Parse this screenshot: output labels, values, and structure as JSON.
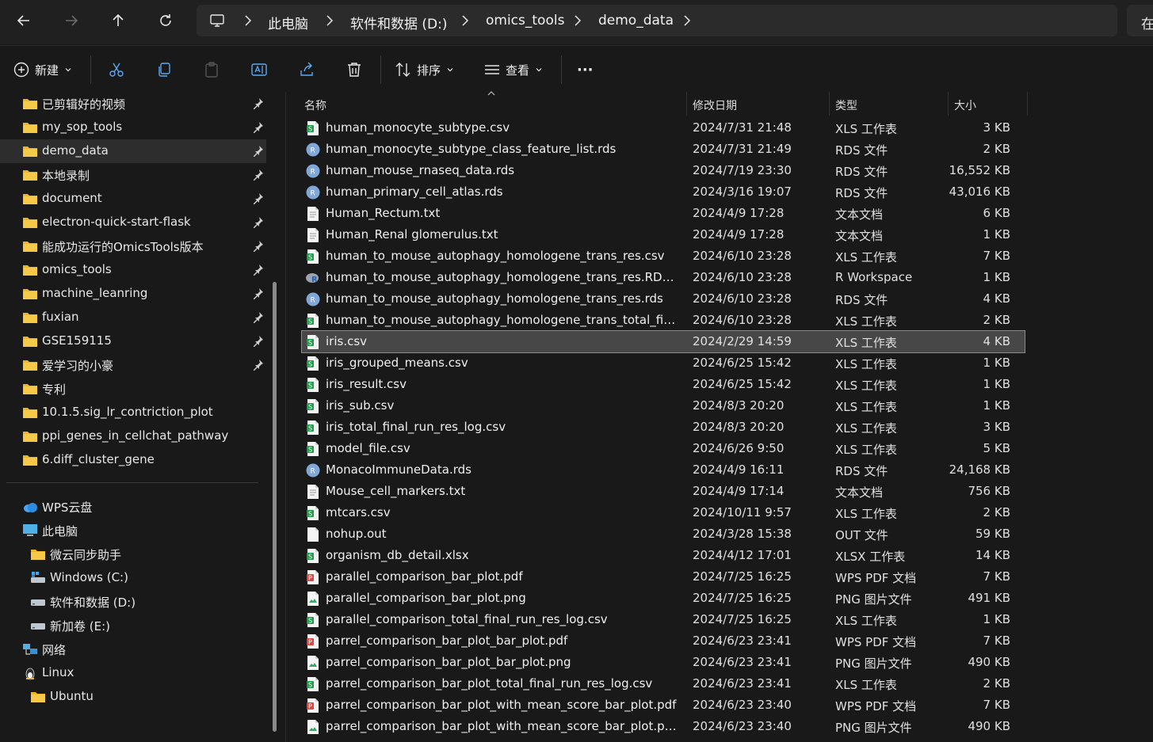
{
  "nav": {
    "back_icon": "arrow-left-icon",
    "forward_icon": "arrow-right-icon",
    "up_icon": "arrow-up-icon",
    "refresh_icon": "refresh-icon"
  },
  "breadcrumb": [
    {
      "label": "此电脑"
    },
    {
      "label": "软件和数据 (D:)"
    },
    {
      "label": "omics_tools"
    },
    {
      "label": "demo_data"
    }
  ],
  "search": {
    "label": "在"
  },
  "toolbar": {
    "new_label": "新建",
    "sort_label": "排序",
    "view_label": "查看",
    "more_label": "···"
  },
  "sidebar": {
    "quick": [
      {
        "label": "已剪辑好的视频",
        "pinned": true
      },
      {
        "label": "my_sop_tools",
        "pinned": true
      },
      {
        "label": "demo_data",
        "pinned": true,
        "selected": true
      },
      {
        "label": "本地录制",
        "pinned": true
      },
      {
        "label": "document",
        "pinned": true
      },
      {
        "label": "electron-quick-start-flask",
        "pinned": true
      },
      {
        "label": "能成功运行的OmicsTools版本",
        "pinned": true
      },
      {
        "label": "omics_tools",
        "pinned": true
      },
      {
        "label": "machine_leanring",
        "pinned": true
      },
      {
        "label": "fuxian",
        "pinned": true
      },
      {
        "label": "GSE159115",
        "pinned": true
      },
      {
        "label": "爱学习的小豪",
        "pinned": true
      },
      {
        "label": "专利",
        "pinned": false
      },
      {
        "label": "10.1.5.sig_lr_contriction_plot",
        "pinned": false
      },
      {
        "label": "ppi_genes_in_cellchat_pathway",
        "pinned": false
      },
      {
        "label": "6.diff_cluster_gene",
        "pinned": false
      }
    ],
    "tree": [
      {
        "label": "WPS云盘",
        "icon": "cloud-icon",
        "indent": 0
      },
      {
        "label": "此电脑",
        "icon": "computer-icon",
        "indent": 0
      },
      {
        "label": "微云同步助手",
        "icon": "folder-icon",
        "indent": 1
      },
      {
        "label": "Windows  (C:)",
        "icon": "windows-drive-icon",
        "indent": 1
      },
      {
        "label": "软件和数据 (D:)",
        "icon": "drive-icon",
        "indent": 1
      },
      {
        "label": "新加卷 (E:)",
        "icon": "drive-icon",
        "indent": 1
      },
      {
        "label": "网络",
        "icon": "network-icon",
        "indent": 0
      },
      {
        "label": "Linux",
        "icon": "linux-icon",
        "indent": 0
      },
      {
        "label": "Ubuntu",
        "icon": "folder-icon",
        "indent": 1
      }
    ]
  },
  "columns": {
    "name": "名称",
    "date": "修改日期",
    "type": "类型",
    "size": "大小"
  },
  "files": [
    {
      "name": "human_monocyte_subtype.csv",
      "date": "2024/7/31 21:48",
      "type": "XLS 工作表",
      "size": "3 KB",
      "icon": "csv"
    },
    {
      "name": "human_monocyte_subtype_class_feature_list.rds",
      "date": "2024/7/31 21:49",
      "type": "RDS 文件",
      "size": "2 KB",
      "icon": "rds"
    },
    {
      "name": "human_mouse_rnaseq_data.rds",
      "date": "2024/7/19 23:30",
      "type": "RDS 文件",
      "size": "16,552 KB",
      "icon": "rds"
    },
    {
      "name": "human_primary_cell_atlas.rds",
      "date": "2024/3/16 19:07",
      "type": "RDS 文件",
      "size": "43,016 KB",
      "icon": "rds"
    },
    {
      "name": "Human_Rectum.txt",
      "date": "2024/4/9 17:28",
      "type": "文本文档",
      "size": "6 KB",
      "icon": "txt"
    },
    {
      "name": "Human_Renal glomerulus.txt",
      "date": "2024/4/9 17:28",
      "type": "文本文档",
      "size": "1 KB",
      "icon": "txt"
    },
    {
      "name": "human_to_mouse_autophagy_homologene_trans_res.csv",
      "date": "2024/6/10 23:28",
      "type": "XLS 工作表",
      "size": "7 KB",
      "icon": "csv"
    },
    {
      "name": "human_to_mouse_autophagy_homologene_trans_res.RData",
      "date": "2024/6/10 23:28",
      "type": "R Workspace",
      "size": "1 KB",
      "icon": "rdata"
    },
    {
      "name": "human_to_mouse_autophagy_homologene_trans_res.rds",
      "date": "2024/6/10 23:28",
      "type": "RDS 文件",
      "size": "4 KB",
      "icon": "rds"
    },
    {
      "name": "human_to_mouse_autophagy_homologene_trans_total_fina...",
      "date": "2024/6/10 23:28",
      "type": "XLS 工作表",
      "size": "2 KB",
      "icon": "csv"
    },
    {
      "name": "iris.csv",
      "date": "2024/2/29 14:59",
      "type": "XLS 工作表",
      "size": "4 KB",
      "icon": "csv",
      "selected": true
    },
    {
      "name": "iris_grouped_means.csv",
      "date": "2024/6/25 15:42",
      "type": "XLS 工作表",
      "size": "1 KB",
      "icon": "csv"
    },
    {
      "name": "iris_result.csv",
      "date": "2024/6/25 15:42",
      "type": "XLS 工作表",
      "size": "1 KB",
      "icon": "csv"
    },
    {
      "name": "iris_sub.csv",
      "date": "2024/8/3 20:20",
      "type": "XLS 工作表",
      "size": "1 KB",
      "icon": "csv"
    },
    {
      "name": "iris_total_final_run_res_log.csv",
      "date": "2024/8/3 20:20",
      "type": "XLS 工作表",
      "size": "3 KB",
      "icon": "csv"
    },
    {
      "name": "model_file.csv",
      "date": "2024/6/26 9:50",
      "type": "XLS 工作表",
      "size": "5 KB",
      "icon": "csv"
    },
    {
      "name": "MonacoImmuneData.rds",
      "date": "2024/4/9 16:11",
      "type": "RDS 文件",
      "size": "24,168 KB",
      "icon": "rds"
    },
    {
      "name": "Mouse_cell_markers.txt",
      "date": "2024/4/9 17:14",
      "type": "文本文档",
      "size": "756 KB",
      "icon": "txt"
    },
    {
      "name": "mtcars.csv",
      "date": "2024/10/11 9:57",
      "type": "XLS 工作表",
      "size": "2 KB",
      "icon": "csv"
    },
    {
      "name": "nohup.out",
      "date": "2024/3/28 15:38",
      "type": "OUT 文件",
      "size": "59 KB",
      "icon": "blank"
    },
    {
      "name": "organism_db_detail.xlsx",
      "date": "2024/4/12 17:01",
      "type": "XLSX 工作表",
      "size": "14 KB",
      "icon": "xlsx"
    },
    {
      "name": "parallel_comparison_bar_plot.pdf",
      "date": "2024/7/25 16:25",
      "type": "WPS PDF 文档",
      "size": "7 KB",
      "icon": "pdf"
    },
    {
      "name": "parallel_comparison_bar_plot.png",
      "date": "2024/7/25 16:25",
      "type": "PNG 图片文件",
      "size": "491 KB",
      "icon": "png"
    },
    {
      "name": "parallel_comparison_total_final_run_res_log.csv",
      "date": "2024/7/25 16:25",
      "type": "XLS 工作表",
      "size": "1 KB",
      "icon": "csv"
    },
    {
      "name": "parrel_comparison_bar_plot_bar_plot.pdf",
      "date": "2024/6/23 23:41",
      "type": "WPS PDF 文档",
      "size": "7 KB",
      "icon": "pdf"
    },
    {
      "name": "parrel_comparison_bar_plot_bar_plot.png",
      "date": "2024/6/23 23:41",
      "type": "PNG 图片文件",
      "size": "490 KB",
      "icon": "png"
    },
    {
      "name": "parrel_comparison_bar_plot_total_final_run_res_log.csv",
      "date": "2024/6/23 23:41",
      "type": "XLS 工作表",
      "size": "2 KB",
      "icon": "csv"
    },
    {
      "name": "parrel_comparison_bar_plot_with_mean_score_bar_plot.pdf",
      "date": "2024/6/23 23:40",
      "type": "WPS PDF 文档",
      "size": "7 KB",
      "icon": "pdf"
    },
    {
      "name": "parrel_comparison_bar_plot_with_mean_score_bar_plot.png",
      "date": "2024/6/23 23:40",
      "type": "PNG 图片文件",
      "size": "490 KB",
      "icon": "png"
    }
  ]
}
